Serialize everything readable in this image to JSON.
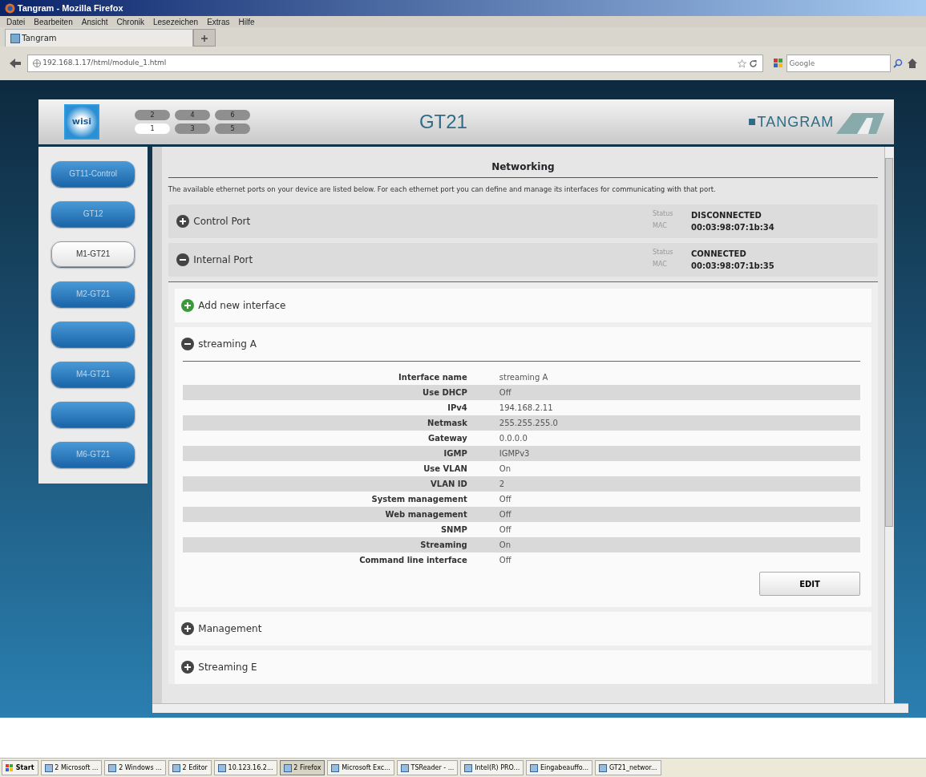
{
  "window": {
    "title": "Tangram - Mozilla Firefox"
  },
  "menu": [
    "Datei",
    "Bearbeiten",
    "Ansicht",
    "Chronik",
    "Lesezeichen",
    "Extras",
    "Hilfe"
  ],
  "tabs": [
    {
      "label": "Tangram",
      "selected": true
    }
  ],
  "address": {
    "url": "192.168.1.17/html/module_1.html"
  },
  "search": {
    "placeholder": "Google"
  },
  "header": {
    "logo": "wisi",
    "title": "GT21",
    "brand": "TANGRAM",
    "unit_buttons": [
      {
        "label": "2",
        "selected": false
      },
      {
        "label": "4",
        "selected": false
      },
      {
        "label": "6",
        "selected": false
      },
      {
        "label": "1",
        "selected": true
      },
      {
        "label": "3",
        "selected": false
      },
      {
        "label": "5",
        "selected": false
      }
    ]
  },
  "sidebar": {
    "items": [
      {
        "label": "GT11-Control",
        "selected": false
      },
      {
        "label": "GT12",
        "selected": false
      },
      {
        "label": "M1-GT21",
        "selected": true
      },
      {
        "label": "M2-GT21",
        "selected": false
      },
      {
        "selected": false
      },
      {
        "label": "M4-GT21",
        "selected": false
      },
      {
        "selected": false
      },
      {
        "label": "M6-GT21",
        "selected": false
      }
    ]
  },
  "networking": {
    "title": "Networking",
    "description": "The available ethernet ports on your device are listed below. For each ethernet port you can define and manage its interfaces for communicating with that port.",
    "ports": [
      {
        "name": "Control Port",
        "expanded": false,
        "status_label": "Status",
        "status": "DISCONNECTED",
        "mac_label": "MAC",
        "mac": "00:03:98:07:1b:34"
      },
      {
        "name": "Internal Port",
        "expanded": true,
        "status_label": "Status",
        "status": "CONNECTED",
        "mac_label": "MAC",
        "mac": "00:03:98:07:1b:35",
        "interfaces": [
          {
            "kind": "add",
            "name": "Add new interface"
          },
          {
            "kind": "interface",
            "name": "streaming A",
            "expanded": true,
            "edit_button": "EDIT",
            "fields": [
              {
                "label": "Interface name",
                "value": "streaming A"
              },
              {
                "label": "Use DHCP",
                "value": "Off"
              },
              {
                "label": "IPv4",
                "value": "194.168.2.11"
              },
              {
                "label": "Netmask",
                "value": "255.255.255.0"
              },
              {
                "label": "Gateway",
                "value": "0.0.0.0"
              },
              {
                "label": "IGMP",
                "value": "IGMPv3"
              },
              {
                "label": "Use VLAN",
                "value": "On"
              },
              {
                "label": "VLAN ID",
                "value": "2"
              },
              {
                "label": "System management",
                "value": "Off"
              },
              {
                "label": "Web management",
                "value": "Off"
              },
              {
                "label": "SNMP",
                "value": "Off"
              },
              {
                "label": "Streaming",
                "value": "On"
              },
              {
                "label": "Command line interface",
                "value": "Off"
              }
            ]
          },
          {
            "kind": "interface",
            "name": "Management",
            "expanded": false
          },
          {
            "kind": "interface",
            "name": "Streaming E",
            "expanded": false
          }
        ]
      }
    ]
  },
  "taskbar": {
    "start": "Start",
    "items": [
      {
        "label": "2 Microsoft ...",
        "selected": false
      },
      {
        "label": "2 Windows ...",
        "selected": false
      },
      {
        "label": "2 Editor",
        "selected": false
      },
      {
        "label": "10.123.16.2...",
        "selected": false
      },
      {
        "label": "2 Firefox",
        "selected": true
      },
      {
        "label": "Microsoft Exc...",
        "selected": false
      },
      {
        "label": "TSReader - ...",
        "selected": false
      },
      {
        "label": "Intel(R) PRO...",
        "selected": false
      },
      {
        "label": "Eingabeauffo...",
        "selected": false
      },
      {
        "label": "GT21_networ...",
        "selected": false
      }
    ]
  }
}
